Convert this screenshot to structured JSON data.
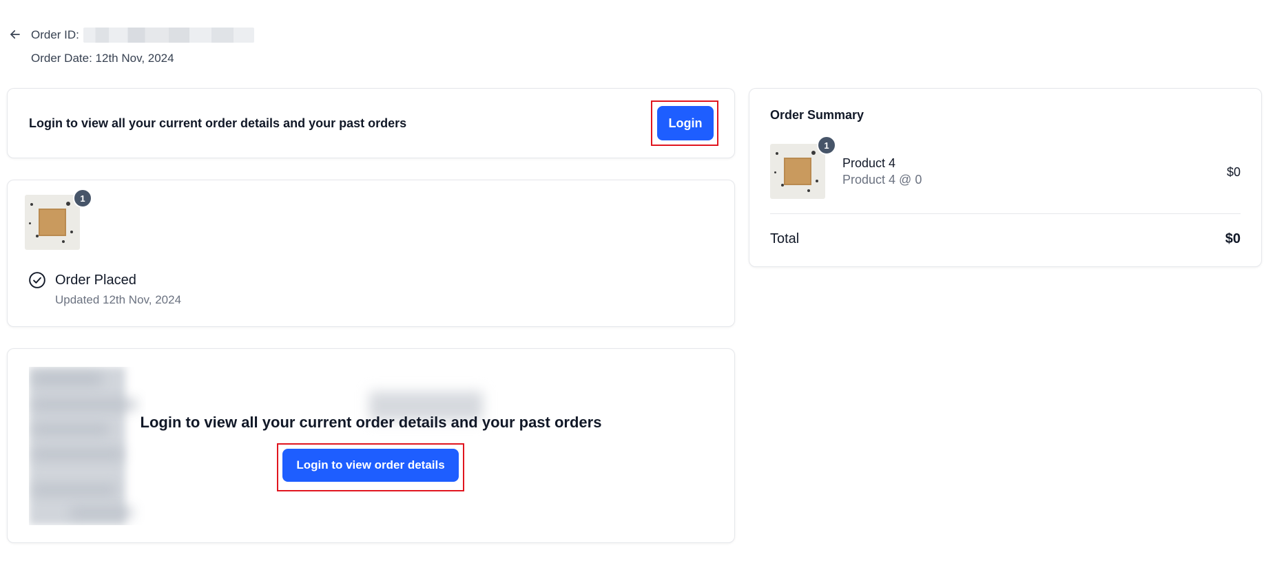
{
  "header": {
    "order_id_label": "Order ID:",
    "order_date": "Order Date: 12th Nov, 2024"
  },
  "login_banner": {
    "message": "Login to view all your current order details and your past orders",
    "button_label": "Login"
  },
  "order_status": {
    "item_count": "1",
    "title": "Order Placed",
    "updated": "Updated 12th Nov, 2024"
  },
  "order_details_locked": {
    "message": "Login to view all your current order details and your past orders",
    "button_label": "Login to view order details"
  },
  "summary": {
    "title": "Order Summary",
    "items": [
      {
        "name": "Product 4",
        "detail": "Product 4 @ 0",
        "price": "$0",
        "qty": "1"
      }
    ],
    "total_label": "Total",
    "total_value": "$0"
  },
  "colors": {
    "primary": "#1e5eff",
    "highlight": "#e0141e",
    "badge": "#475569"
  },
  "icons": [
    "arrow-left-icon",
    "check-circle-icon"
  ]
}
